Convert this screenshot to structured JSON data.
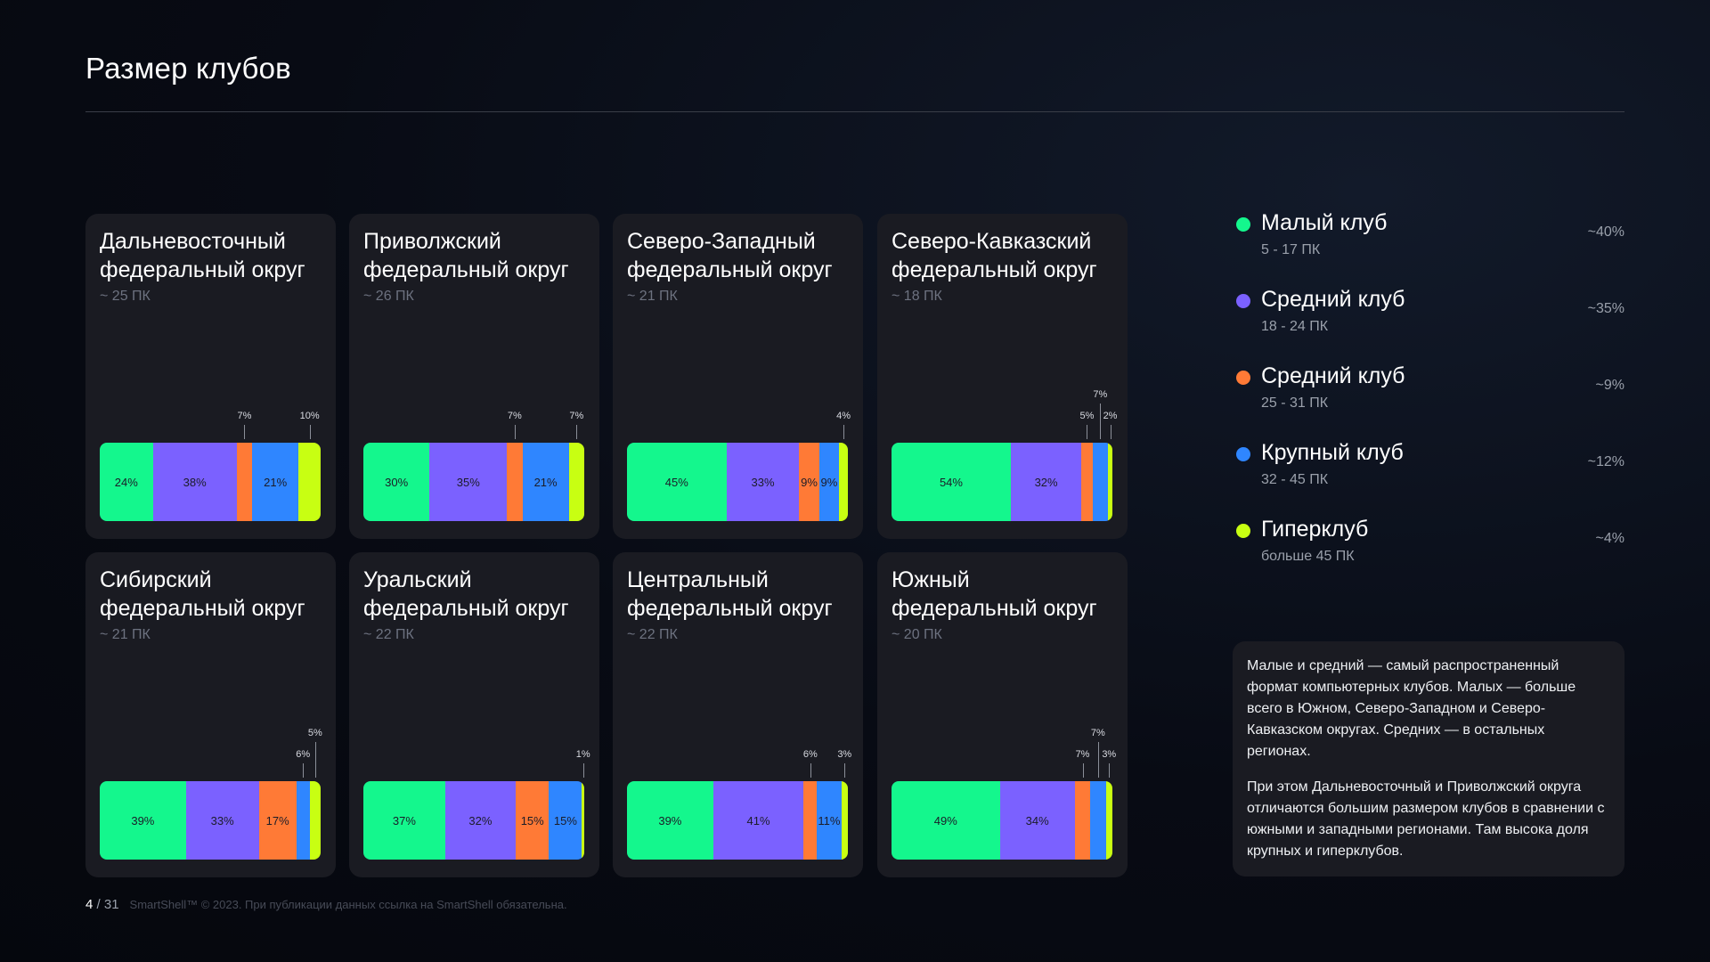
{
  "title": "Размер клубов",
  "colors": {
    "small": "#14f78d",
    "medium": "#7b61ff",
    "medium2": "#ff7a36",
    "large": "#2f86ff",
    "hyper": "#c8ff12"
  },
  "legend": [
    {
      "key": "small",
      "name": "Малый клуб",
      "range": "5 - 17 ПК",
      "share": "~40%"
    },
    {
      "key": "medium",
      "name": "Средний клуб",
      "range": "18 - 24 ПК",
      "share": "~35%"
    },
    {
      "key": "medium2",
      "name": "Средний клуб",
      "range": "25 - 31 ПК",
      "share": "~9%"
    },
    {
      "key": "large",
      "name": "Крупный клуб",
      "range": "32 - 45 ПК",
      "share": "~12%"
    },
    {
      "key": "hyper",
      "name": "Гиперклуб",
      "range": "больше 45 ПК",
      "share": "~4%"
    }
  ],
  "chart_data": [
    {
      "type": "bar",
      "stacked": true,
      "title": [
        "Дальневосточный",
        "федеральный округ"
      ],
      "subtitle": "~ 25 ПК",
      "values": [
        24,
        38,
        7,
        21,
        10
      ],
      "labels": [
        "24%",
        "38%",
        "7%",
        "21%",
        "10%"
      ],
      "outside": [
        false,
        false,
        true,
        false,
        true
      ]
    },
    {
      "type": "bar",
      "stacked": true,
      "title": [
        "Приволжский",
        "федеральный округ"
      ],
      "subtitle": "~ 26 ПК",
      "values": [
        30,
        35,
        7,
        21,
        7
      ],
      "labels": [
        "30%",
        "35%",
        "7%",
        "21%",
        "7%"
      ],
      "outside": [
        false,
        false,
        true,
        false,
        true
      ]
    },
    {
      "type": "bar",
      "stacked": true,
      "title": [
        "Северо-Западный",
        "федеральный округ"
      ],
      "subtitle": "~ 21 ПК",
      "values": [
        45,
        33,
        9,
        9,
        4
      ],
      "labels": [
        "45%",
        "33%",
        "9%",
        "9%",
        "4%"
      ],
      "outside": [
        false,
        false,
        false,
        false,
        true
      ]
    },
    {
      "type": "bar",
      "stacked": true,
      "title": [
        "Северо-Кавказский",
        "федеральный округ"
      ],
      "subtitle": "~ 18 ПК",
      "values": [
        54,
        32,
        5,
        7,
        2
      ],
      "labels": [
        "54%",
        "32%",
        "5%",
        "7%",
        "2%"
      ],
      "outside": [
        false,
        false,
        true,
        true,
        true
      ]
    },
    {
      "type": "bar",
      "stacked": true,
      "title": [
        "Сибирский",
        "федеральный округ"
      ],
      "subtitle": "~ 21 ПК",
      "values": [
        39,
        33,
        17,
        6,
        5
      ],
      "labels": [
        "39%",
        "33%",
        "17%",
        "6%",
        "5%"
      ],
      "outside": [
        false,
        false,
        false,
        true,
        true
      ]
    },
    {
      "type": "bar",
      "stacked": true,
      "title": [
        "Уральский",
        "федеральный округ"
      ],
      "subtitle": "~ 22 ПК",
      "values": [
        37,
        32,
        15,
        15,
        1
      ],
      "labels": [
        "37%",
        "32%",
        "15%",
        "15%",
        "1%"
      ],
      "outside": [
        false,
        false,
        false,
        false,
        true
      ]
    },
    {
      "type": "bar",
      "stacked": true,
      "title": [
        "Центральный",
        "федеральный округ"
      ],
      "subtitle": "~ 22 ПК",
      "values": [
        39,
        41,
        6,
        11,
        3
      ],
      "labels": [
        "39%",
        "41%",
        "6%",
        "11%",
        "3%"
      ],
      "outside": [
        false,
        false,
        true,
        false,
        true
      ]
    },
    {
      "type": "bar",
      "stacked": true,
      "title": [
        "Южный",
        "федеральный округ"
      ],
      "subtitle": "~ 20 ПК",
      "values": [
        49,
        34,
        7,
        7,
        3
      ],
      "labels": [
        "49%",
        "34%",
        "7%",
        "7%",
        "3%"
      ],
      "outside": [
        false,
        false,
        true,
        true,
        true
      ]
    }
  ],
  "note": {
    "p1": "Малые и средний — самый распространенный формат компьютерных клубов. Малых — больше всего в Южном, Северо-Западном и Северо-Кавказском округах. Средних — в остальных регионах.",
    "p2": "При этом Дальневосточный и Приволжский округа отличаются большим размером клубов в сравнении с южными и западными регионами. Там высока доля крупных и гиперклубов."
  },
  "footer": {
    "page": "4",
    "total": " / 31",
    "copyright": "SmartShell™ © 2023. При публикации данных ссылка на SmartShell обязательна."
  }
}
